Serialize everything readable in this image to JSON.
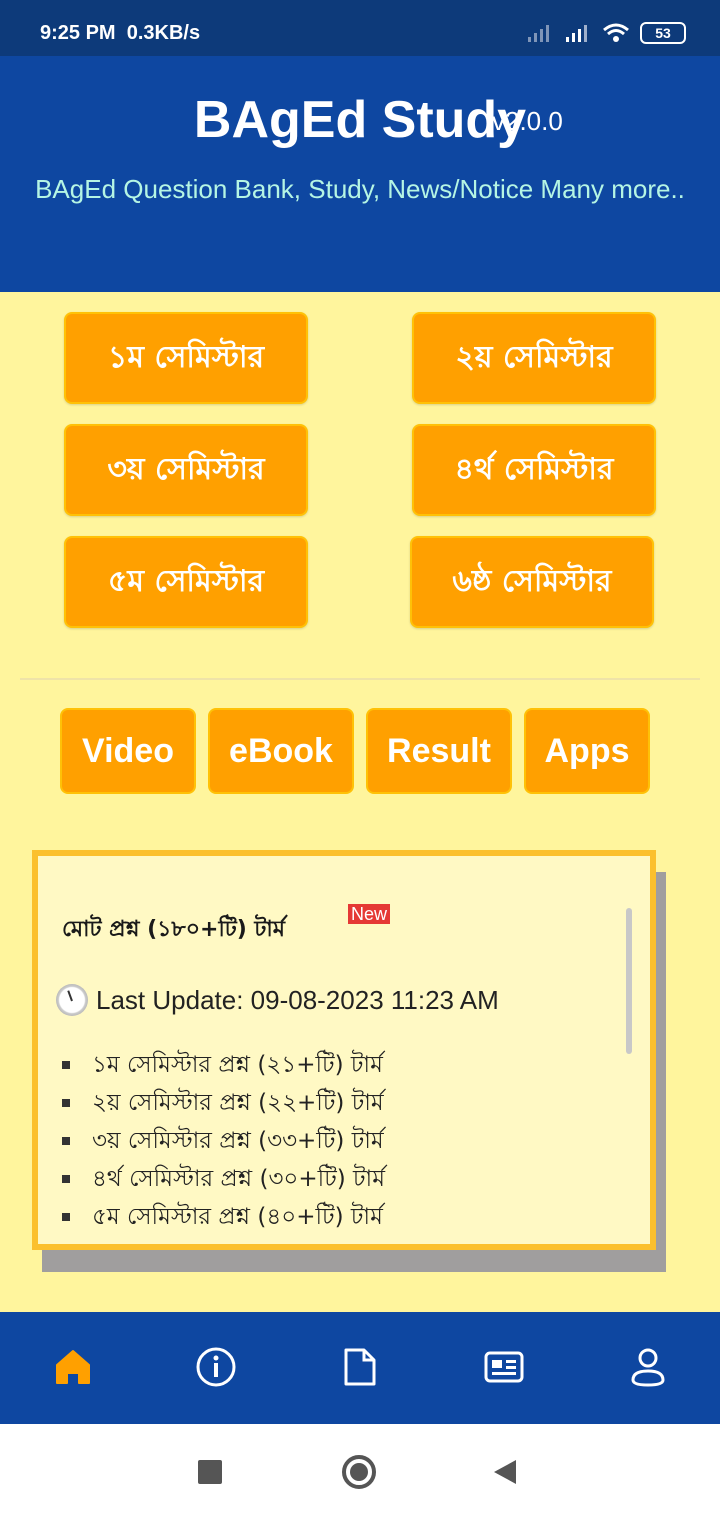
{
  "status_bar": {
    "time": "9:25 PM",
    "speed": "0.3KB/s",
    "battery": "53"
  },
  "header": {
    "title": "BAgEd Study",
    "version": "v2.0.0",
    "subtitle": "BAgEd Question Bank, Study, News/Notice Many more.."
  },
  "semesters": [
    {
      "label": "১ম সেমিস্টার"
    },
    {
      "label": "২য় সেমিস্টার"
    },
    {
      "label": "৩য় সেমিস্টার"
    },
    {
      "label": "৪র্থ সেমিস্টার"
    },
    {
      "label": "৫ম সেমিস্টার"
    },
    {
      "label": "৬ষ্ঠ সেমিস্টার"
    }
  ],
  "links": [
    {
      "label": "Video"
    },
    {
      "label": "eBook"
    },
    {
      "label": "Result"
    },
    {
      "label": "Apps"
    }
  ],
  "notice": {
    "title": "মোট প্রশ্ন (১৮০+টি) টার্ম",
    "badge": "New",
    "last_update": "Last Update: 09-08-2023 11:23 AM",
    "items": [
      "১ম সেমিস্টার প্রশ্ন (২১+টি) টার্ম",
      "২য় সেমিস্টার প্রশ্ন (২২+টি) টার্ম",
      "৩য় সেমিস্টার প্রশ্ন (৩৩+টি) টার্ম",
      "৪র্থ সেমিস্টার প্রশ্ন (৩০+টি) টার্ম",
      "৫ম সেমিস্টার প্রশ্ন (৪০+টি) টার্ম"
    ]
  },
  "bottom_nav": [
    {
      "icon": "home-icon",
      "active": true
    },
    {
      "icon": "info-icon"
    },
    {
      "icon": "document-icon"
    },
    {
      "icon": "news-icon"
    },
    {
      "icon": "profile-icon"
    }
  ],
  "colors": {
    "header": "#0e47a1",
    "content_bg": "#fff59d",
    "button": "#ffa000",
    "active_nav": "#ffa000"
  }
}
